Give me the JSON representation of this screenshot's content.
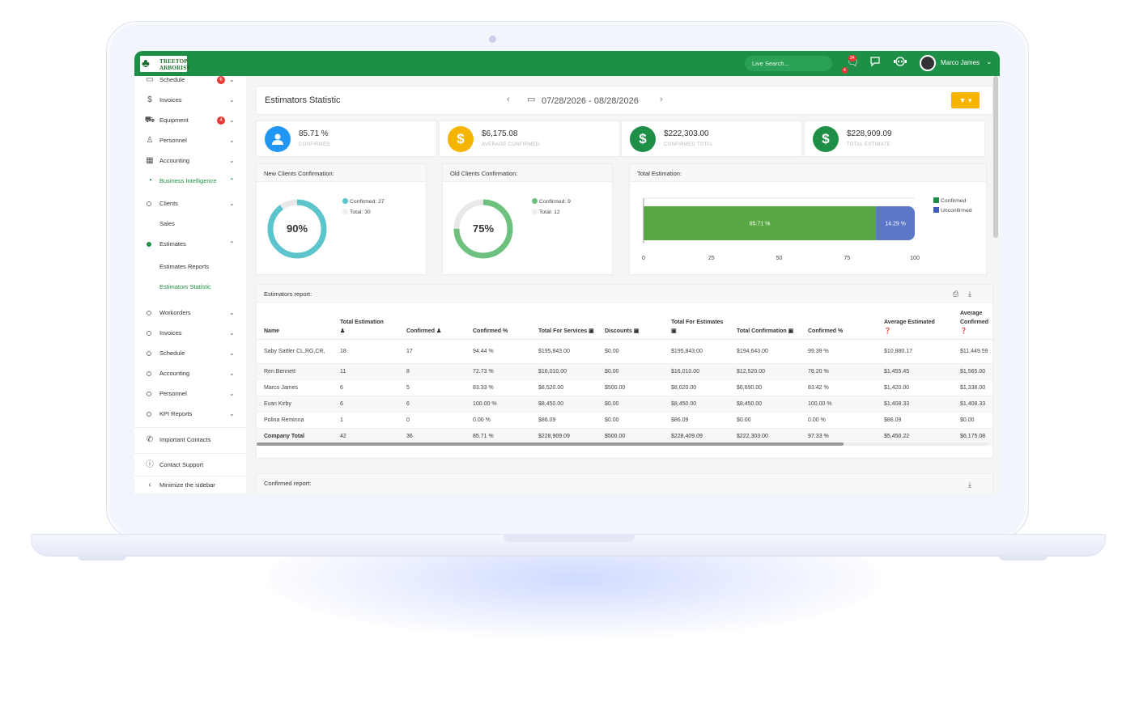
{
  "app": {
    "logo_text_1": "TREETOP",
    "logo_text_2": "ARBORIST",
    "search_placeholder": "Live Search...",
    "notif_badge": "34",
    "notif_badge_2": "4",
    "user_name": "Marco James"
  },
  "sidebar": {
    "items": [
      {
        "label": "Schedule",
        "icon": "calendar-icon",
        "badge": "6"
      },
      {
        "label": "Invoices",
        "icon": "dollar-icon"
      },
      {
        "label": "Equipment",
        "icon": "truck-icon",
        "badge": "4"
      },
      {
        "label": "Personnel",
        "icon": "person-icon"
      },
      {
        "label": "Accounting",
        "icon": "table-icon"
      },
      {
        "label": "Business Intelligence",
        "icon": "pie-icon"
      },
      {
        "label": "Clients"
      },
      {
        "label": "Sales"
      },
      {
        "label": "Estimates"
      },
      {
        "label": "Estimates Reports"
      },
      {
        "label": "Estimators Statistic"
      },
      {
        "label": "Workorders"
      },
      {
        "label": "Invoices"
      },
      {
        "label": "Schedule"
      },
      {
        "label": "Accounting"
      },
      {
        "label": "Personnel"
      },
      {
        "label": "KPI Reports"
      },
      {
        "label": "Important Contacts",
        "icon": "phone-icon"
      },
      {
        "label": "Contact Support",
        "icon": "help-icon"
      },
      {
        "label": "Minimize the sidebar",
        "icon": "chevron-left-icon"
      }
    ]
  },
  "header": {
    "title": "Estimators Statistic",
    "date_range": "07/28/2026 - 08/28/2026"
  },
  "stats": [
    {
      "value": "85.71 %",
      "label": "CONFIRMED",
      "color": "#2196f3",
      "icon": "person-icon"
    },
    {
      "value": "$6,175.08",
      "label": "AVERAGE CONFIRMED",
      "color": "#f5b400",
      "icon": "dollar-icon"
    },
    {
      "value": "$222,303.00",
      "label": "CONFIRMED TOTAL",
      "color": "#1e8f46",
      "icon": "dollar-icon"
    },
    {
      "value": "$228,909.09",
      "label": "TOTAL ESTIMATE",
      "color": "#1e8f46",
      "icon": "dollar-icon"
    }
  ],
  "new_clients": {
    "title": "New Clients Confirmation:",
    "percent_label": "90%",
    "percent": 90,
    "legend_confirmed": "Confirmed: 27",
    "legend_total": "Total: 30",
    "color": "#5bc4cc"
  },
  "old_clients": {
    "title": "Old Clients Confirmation:",
    "percent_label": "75%",
    "percent": 75,
    "legend_confirmed": "Confirmed: 9",
    "legend_total": "Total: 12",
    "color": "#6cc17f"
  },
  "chart_data": {
    "type": "bar",
    "title": "Total Estimation:",
    "orientation": "horizontal-stacked",
    "series": [
      {
        "name": "Confirmed",
        "values": [
          85.71
        ],
        "label": "85.71 %",
        "color": "#5aa843"
      },
      {
        "name": "Unconfirmed",
        "values": [
          14.29
        ],
        "label": "14.29 %",
        "color": "#5c77c7"
      }
    ],
    "xlim": [
      0,
      100
    ],
    "xticks": [
      "0",
      "25",
      "50",
      "75",
      "100"
    ],
    "legend_position": "right"
  },
  "report": {
    "title": "Estimators report:",
    "columns": [
      "Name",
      "Total Estimation",
      "Confirmed",
      "Confirmed %",
      "Total For Services",
      "Discounts",
      "Total For Estimates",
      "Total Confirmation",
      "Confirmed %",
      "Average Estimated",
      "Average Confirmed"
    ],
    "rows": [
      [
        "Saby Sattler CL,RG,CR,",
        "18",
        "17",
        "94.44 %",
        "$195,843.00",
        "$0.00",
        "$195,843.00",
        "$194,643.00",
        "99.39 %",
        "$10,880.17",
        "$11,449.59"
      ],
      [
        "Ren Bennett",
        "11",
        "8",
        "72.73 %",
        "$16,010.00",
        "$0.00",
        "$16,010.00",
        "$12,520.00",
        "78.20 %",
        "$1,455.45",
        "$1,565.00"
      ],
      [
        "Marco James",
        "6",
        "5",
        "83.33 %",
        "$8,520.00",
        "$500.00",
        "$8,020.00",
        "$6,690.00",
        "83.42 %",
        "$1,420.00",
        "$1,338.00"
      ],
      [
        "Evan Kirby",
        "6",
        "6",
        "100.00 %",
        "$8,450.00",
        "$0.00",
        "$8,450.00",
        "$8,450.00",
        "100.00 %",
        "$1,408.33",
        "$1,408.33"
      ],
      [
        "Polina Reminna",
        "1",
        "0",
        "0.00 %",
        "$86.09",
        "$0.00",
        "$86.09",
        "$0.00",
        "0.00 %",
        "$86.09",
        "$0.00"
      ]
    ],
    "total": [
      "Company Total",
      "42",
      "36",
      "85.71 %",
      "$228,909.09",
      "$500.00",
      "$228,409.09",
      "$222,303.00",
      "97.33 %",
      "$5,450.22",
      "$6,175.08"
    ]
  },
  "confirmed_report": {
    "title": "Confirmed report:"
  }
}
